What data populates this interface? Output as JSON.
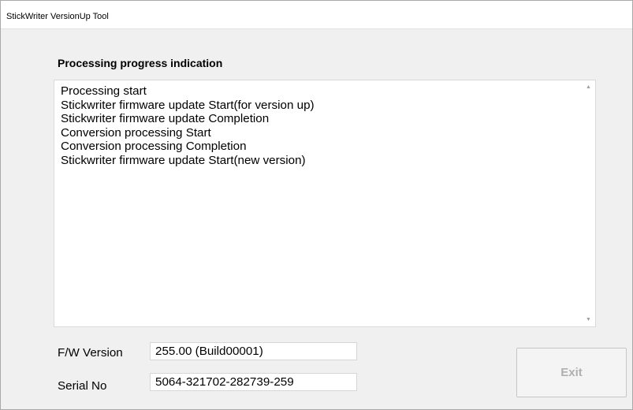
{
  "window": {
    "title": "StickWriter VersionUp Tool"
  },
  "progress": {
    "heading": "Processing progress indication",
    "lines": [
      "Processing start",
      "Stickwriter firmware update Start(for version up)",
      "Stickwriter firmware update Completion",
      "Conversion processing Start",
      "Conversion processing Completion",
      "Stickwriter firmware update Start(new version)"
    ]
  },
  "fields": {
    "fw_version_label": "F/W Version",
    "fw_version_value": "255.00 (Build00001)",
    "serial_label": "Serial No",
    "serial_value": "5064-321702-282739-259"
  },
  "buttons": {
    "exit_label": "Exit",
    "exit_enabled": false
  },
  "icons": {
    "scroll_up": "scroll-up-arrow-icon",
    "scroll_down": "scroll-down-arrow-icon"
  },
  "colors": {
    "window_background": "#f0f0f0",
    "disabled_text": "#b0b0b0"
  }
}
